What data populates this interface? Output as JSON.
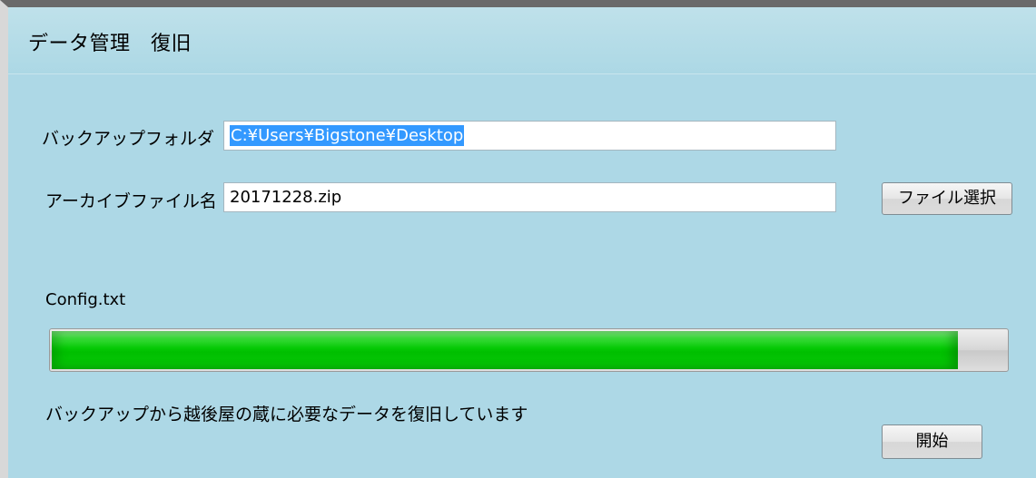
{
  "window": {
    "title": "データ管理　復旧"
  },
  "form": {
    "backup_folder_label": "バックアップフォルダ",
    "backup_folder_value": "C:¥Users¥Bigstone¥Desktop",
    "archive_file_label": "アーカイブファイル名",
    "archive_file_value": "20171228.zip",
    "select_file_button": "ファイル選択"
  },
  "progress": {
    "current_file": "Config.txt",
    "percent": 95,
    "fill_color": "#00c000",
    "status_message": "バックアップから越後屋の蔵に必要なデータを復旧しています"
  },
  "actions": {
    "start_button": "開始"
  },
  "colors": {
    "window_background": "#add8e6",
    "selection_highlight": "#3399ff"
  }
}
